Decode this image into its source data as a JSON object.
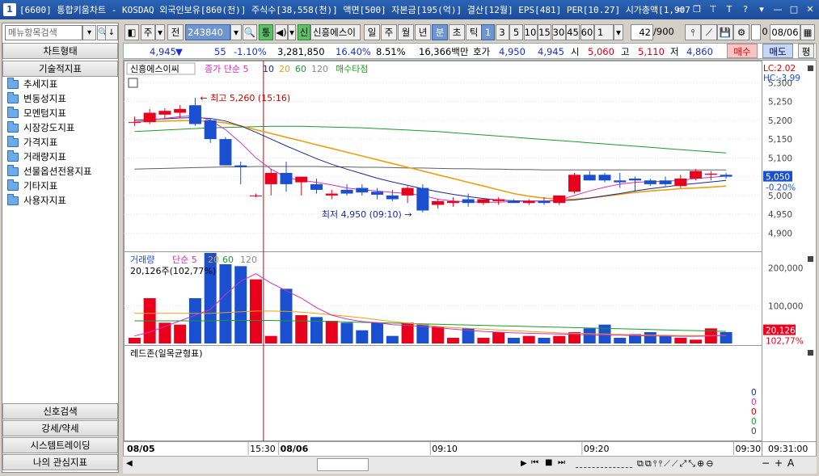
{
  "window": {
    "number": "1",
    "title": "[6600] 통합키움차트 - KOSDAQ 외국인보유[860(천)] 주식수[38,558(천)] 액면[500] 자본금[195(억)] 결산[12월] EPS[481] PER[10.27] 시가총액[1,907"
  },
  "left_panel": {
    "search_placeholder": "메뉴항목검색",
    "chart_type_btn": "차트형태",
    "tech_indicator_btn": "기술적지표",
    "tree": [
      "추세지표",
      "변동성지표",
      "모멘텀지표",
      "시장강도지표",
      "가격지표",
      "거래량지표",
      "선물옵션전용지표",
      "기타지표",
      "사용자지표"
    ],
    "bottom_buttons": [
      "신호검색",
      "강세/약세",
      "시스템트레이딩",
      "나의 관심지표"
    ]
  },
  "toolbar": {
    "period_sel": "주",
    "prev_label": "전",
    "code": "243840",
    "tong": "통",
    "sin": "신",
    "stock_name": "신흥에스이",
    "periods": [
      "일",
      "주",
      "월",
      "년",
      "분",
      "초",
      "틱"
    ],
    "intervals": [
      "1",
      "3",
      "5",
      "10",
      "15",
      "30",
      "45",
      "60"
    ],
    "unit": "1",
    "count": "42",
    "total": "/900",
    "checkbox_label": "0",
    "date": "08/06"
  },
  "quote": {
    "price": "4,945",
    "arrow": "▼",
    "change": "55",
    "rate": "-1.10%",
    "volume": "3,281,850",
    "vol_ratio": "16.40%",
    "turnover": "8.51%",
    "amount": "16,366백만",
    "hoga_label": "호가",
    "ask": "4,950",
    "bid": "4,945",
    "open_label": "시",
    "open": "5,060",
    "high_label": "고",
    "high": "5,110",
    "low_label": "저",
    "low": "4,860",
    "buy": "매수",
    "sell": "매도",
    "eval": "평"
  },
  "chart_data": {
    "type": "candlestick",
    "price_panel": {
      "legend_name": "신흥에스이씨",
      "legend_ma_label": "종가 단순 5",
      "legend_ma": [
        "10",
        "20",
        "60",
        "120"
      ],
      "legend_signal": "매수타점",
      "lc": "LC:2.02",
      "hc": "HC:-3.99",
      "ylim": [
        4860,
        5320
      ],
      "yticks": [
        "5,300",
        "5,250",
        "5,200",
        "5,150",
        "5,100",
        "5,050",
        "5,000",
        "4,950",
        "4,900"
      ],
      "ytick_values": [
        5300,
        5250,
        5200,
        5150,
        5100,
        5050,
        5000,
        4950,
        4900
      ],
      "high_annotation": "최고 5,260 (15:16)",
      "low_annotation": "최저 4,950 (09:10)",
      "current_price": "5,050",
      "current_rate": "-0.20%",
      "candles": [
        {
          "o": 5195,
          "h": 5210,
          "l": 5185,
          "c": 5195
        },
        {
          "o": 5195,
          "h": 5230,
          "l": 5190,
          "c": 5220
        },
        {
          "o": 5215,
          "h": 5232,
          "l": 5205,
          "c": 5225
        },
        {
          "o": 5220,
          "h": 5240,
          "l": 5205,
          "c": 5230
        },
        {
          "o": 5240,
          "h": 5260,
          "l": 5185,
          "c": 5190
        },
        {
          "o": 5200,
          "h": 5205,
          "l": 5140,
          "c": 5150
        },
        {
          "o": 5150,
          "h": 5155,
          "l": 5080,
          "c": 5080
        },
        {
          "o": 5080,
          "h": 5090,
          "l": 5030,
          "c": 5075
        },
        {
          "o": 5000,
          "h": 5005,
          "l": 4995,
          "c": 5000
        },
        {
          "o": 5030,
          "h": 5070,
          "l": 5000,
          "c": 5060
        },
        {
          "o": 5060,
          "h": 5090,
          "l": 5010,
          "c": 5030
        },
        {
          "o": 5035,
          "h": 5045,
          "l": 5000,
          "c": 5050
        },
        {
          "o": 5030,
          "h": 5045,
          "l": 5005,
          "c": 5015
        },
        {
          "o": 5000,
          "h": 5015,
          "l": 4990,
          "c": 5005
        },
        {
          "o": 5015,
          "h": 5030,
          "l": 5000,
          "c": 5005
        },
        {
          "o": 5020,
          "h": 5030,
          "l": 5000,
          "c": 5008
        },
        {
          "o": 5010,
          "h": 5020,
          "l": 4990,
          "c": 5002
        },
        {
          "o": 5000,
          "h": 5015,
          "l": 4985,
          "c": 4990
        },
        {
          "o": 5000,
          "h": 5025,
          "l": 4980,
          "c": 5020
        },
        {
          "o": 5020,
          "h": 5030,
          "l": 4955,
          "c": 4960
        },
        {
          "o": 4975,
          "h": 4990,
          "l": 4965,
          "c": 4985
        },
        {
          "o": 4980,
          "h": 4995,
          "l": 4970,
          "c": 4985
        },
        {
          "o": 4990,
          "h": 5005,
          "l": 4970,
          "c": 4980
        },
        {
          "o": 4980,
          "h": 4990,
          "l": 4975,
          "c": 4990
        },
        {
          "o": 4985,
          "h": 4995,
          "l": 4975,
          "c": 4990
        },
        {
          "o": 4985,
          "h": 4990,
          "l": 4980,
          "c": 4980
        },
        {
          "o": 4980,
          "h": 4990,
          "l": 4975,
          "c": 4985
        },
        {
          "o": 4985,
          "h": 4995,
          "l": 4975,
          "c": 4980
        },
        {
          "o": 4980,
          "h": 5000,
          "l": 4975,
          "c": 5000
        },
        {
          "o": 5010,
          "h": 5060,
          "l": 5005,
          "c": 5055
        },
        {
          "o": 5055,
          "h": 5065,
          "l": 5040,
          "c": 5040
        },
        {
          "o": 5055,
          "h": 5060,
          "l": 5035,
          "c": 5040
        },
        {
          "o": 5040,
          "h": 5060,
          "l": 5020,
          "c": 5035
        },
        {
          "o": 5045,
          "h": 5050,
          "l": 5010,
          "c": 5040
        },
        {
          "o": 5040,
          "h": 5045,
          "l": 5025,
          "c": 5030
        },
        {
          "o": 5040,
          "h": 5050,
          "l": 5025,
          "c": 5030
        },
        {
          "o": 5025,
          "h": 5055,
          "l": 5020,
          "c": 5045
        },
        {
          "o": 5045,
          "h": 5070,
          "l": 5040,
          "c": 5065
        },
        {
          "o": 5055,
          "h": 5065,
          "l": 5040,
          "c": 5058
        },
        {
          "o": 5055,
          "h": 5060,
          "l": 5045,
          "c": 5050
        }
      ],
      "ma5": [
        5195,
        5200,
        5205,
        5210,
        5212,
        5200,
        5175,
        5140,
        5100,
        5070,
        5048,
        5040,
        5035,
        5028,
        5020,
        5015,
        5012,
        5008,
        5005,
        5000,
        4990,
        4985,
        4983,
        4982,
        4982,
        4984,
        4985,
        4985,
        4988,
        5000,
        5012,
        5022,
        5030,
        5035,
        5037,
        5038,
        5040,
        5045,
        5048,
        5052
      ],
      "ma10": [
        5200,
        5202,
        5204,
        5206,
        5207,
        5205,
        5198,
        5185,
        5168,
        5150,
        5132,
        5115,
        5098,
        5083,
        5070,
        5058,
        5046,
        5036,
        5027,
        5018,
        5010,
        5003,
        4997,
        4992,
        4988,
        4986,
        4985,
        4985,
        4986,
        4988,
        4993,
        4999,
        5005,
        5012,
        5018,
        5023,
        5028,
        5032,
        5036,
        5040
      ],
      "ma20": [
        5195,
        5197,
        5198,
        5199,
        5199,
        5197,
        5193,
        5185,
        5175,
        5165,
        5155,
        5145,
        5135,
        5125,
        5115,
        5105,
        5095,
        5085,
        5075,
        5065,
        5055,
        5045,
        5035,
        5025,
        5015,
        5005,
        4998,
        4993,
        4990,
        4990,
        4993,
        4998,
        5003,
        5008,
        5012,
        5015,
        5018,
        5020,
        5022,
        5025
      ],
      "ma60": [
        5170,
        5172,
        5174,
        5176,
        5178,
        5180,
        5181,
        5182,
        5183,
        5184,
        5184,
        5184,
        5183,
        5182,
        5181,
        5180,
        5178,
        5176,
        5174,
        5172,
        5170,
        5167,
        5164,
        5161,
        5158,
        5155,
        5152,
        5149,
        5146,
        5143,
        5140,
        5137,
        5134,
        5131,
        5128,
        5125,
        5122,
        5119,
        5116,
        5113
      ],
      "ma120": [
        5070,
        5071,
        5072,
        5073,
        5074,
        5075,
        5076,
        5076,
        5077,
        5077,
        5077,
        5077,
        5077,
        5076,
        5076,
        5075,
        5075,
        5074,
        5073,
        5073,
        5072,
        5071,
        5071,
        5070,
        5070,
        5069,
        5069,
        5068,
        5068,
        5068,
        5068,
        5068,
        5068,
        5068,
        5068,
        5068,
        5068,
        5068,
        5068,
        5068
      ]
    },
    "volume_panel": {
      "legend_name": "거래량",
      "legend_ma_label": "단순 5",
      "legend_ma": [
        "20",
        "60",
        "120"
      ],
      "value_label": "20,126주(102,77%)",
      "ylim": [
        0,
        240000
      ],
      "yticks": [
        "200,000",
        "100,000"
      ],
      "ytick_values": [
        200000,
        100000
      ],
      "current_volume": "20,126",
      "current_rate": "102,77%",
      "values": [
        15000,
        120000,
        55000,
        50000,
        120000,
        240000,
        210000,
        205000,
        170000,
        20000,
        145000,
        75000,
        70000,
        60000,
        55000,
        35000,
        55000,
        20000,
        55000,
        50000,
        45000,
        15000,
        40000,
        15000,
        30000,
        15000,
        20000,
        15000,
        20000,
        30000,
        40000,
        50000,
        15000,
        25000,
        30000,
        20000,
        15000,
        10000,
        40000,
        30000
      ],
      "ma5": [
        20000,
        30000,
        45000,
        60000,
        75000,
        90000,
        130000,
        165000,
        185000,
        160000,
        140000,
        120000,
        95000,
        75000,
        65000,
        58000,
        55000,
        50000,
        48000,
        45000,
        42000,
        38000,
        35000,
        32000,
        30000,
        28000,
        27000,
        26000,
        25000,
        24000,
        23000,
        22000,
        22000,
        21000,
        20000,
        20000,
        19000,
        19000,
        20000,
        21000
      ],
      "ma20": [
        80000,
        80000,
        80000,
        80000,
        80000,
        80000,
        82000,
        84000,
        86000,
        86000,
        85000,
        83000,
        80000,
        76000,
        72000,
        68000,
        63000,
        58000,
        54000,
        50000,
        45000,
        42000,
        40000,
        38000,
        36000,
        34000,
        32000,
        30000,
        28000,
        27000,
        26000,
        25000,
        24000,
        23000,
        22000,
        22000,
        21000,
        21000,
        21000,
        21000
      ],
      "ma60": [
        60000,
        60000,
        60000,
        60000,
        60000,
        60000,
        61000,
        61000,
        61000,
        61000,
        60000,
        60000,
        59000,
        58000,
        57000,
        56000,
        55000,
        54000,
        53000,
        52000,
        51000,
        50000,
        49000,
        48000,
        47000,
        46000,
        45000,
        44000,
        43000,
        42000,
        41000,
        40000,
        39000,
        38000,
        37000,
        36000,
        35000,
        34000,
        33000,
        32000
      ]
    },
    "ichimoku_panel": {
      "legend": "레드존(일목균형표)",
      "right_values": [
        "0",
        "0",
        "0",
        "0",
        "0"
      ]
    },
    "x_labels": [
      "08/05",
      "15:30",
      "08/06",
      "09:10",
      "09:20",
      "09:30"
    ],
    "x_label_index": [
      0,
      8,
      10,
      20,
      30,
      40
    ],
    "time_readout": "09:31:00",
    "colors": {
      "up": "#e8001c",
      "down": "#1a4fd0",
      "ma5": "#d030c0",
      "ma10": "#1a2a8a",
      "ma20": "#e8a010",
      "ma60": "#1a9a30",
      "ma120": "#606060",
      "vline": "#e00000"
    }
  }
}
